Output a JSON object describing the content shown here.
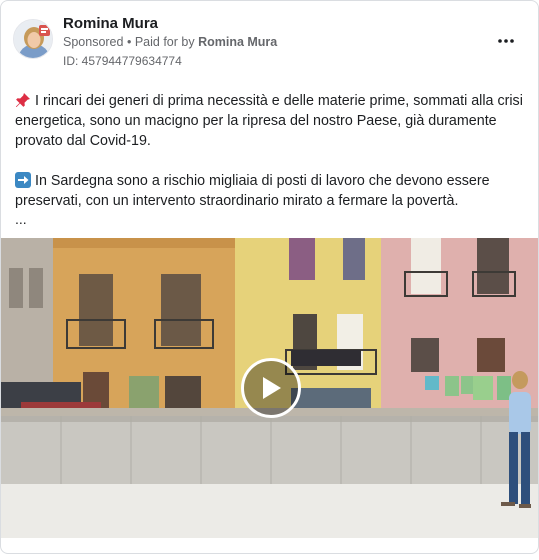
{
  "post": {
    "author": "Romina Mura",
    "sponsored_label": "Sponsored",
    "separator": "•",
    "paid_for_prefix": "Paid for by",
    "paid_for_by": "Romina Mura",
    "ad_id": "ID: 457944779634774",
    "more_icon": "more-horizontal-icon",
    "paragraph_1_icon": "pushpin-icon",
    "paragraph_1": "I rincari dei generi di prima necessità e delle materie prime, sommati alla crisi energetica, sono un macigno per la ripresa del nostro Paese, già duramente provato dal Covid-19.",
    "paragraph_2_icon": "right-arrow-icon",
    "paragraph_2": "In Sardegna sono a rischio migliaia di posti di lavoro che devono essere preservati, con un intervento straordinario mirato a fermare la povertà.",
    "truncation": "...",
    "video_icon": "play-icon"
  },
  "colors": {
    "text_primary": "#1c1e21",
    "text_secondary": "#65676b",
    "border": "#dadde1",
    "arrow_emoji_bg": "#3b88c3",
    "pin_emoji": "#dd2e44"
  }
}
